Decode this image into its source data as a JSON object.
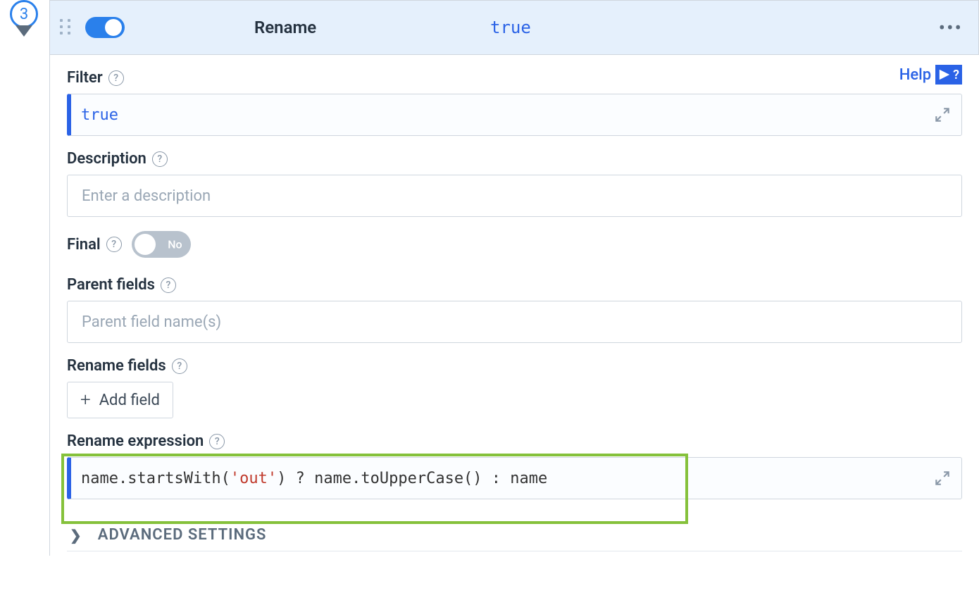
{
  "step": {
    "number": "3"
  },
  "header": {
    "title": "Rename",
    "value": "true"
  },
  "help": {
    "label": "Help"
  },
  "filter": {
    "label": "Filter",
    "value": "true"
  },
  "description": {
    "label": "Description",
    "placeholder": "Enter a description"
  },
  "final": {
    "label": "Final",
    "toggle_label": "No"
  },
  "parent": {
    "label": "Parent fields",
    "placeholder": "Parent field name(s)"
  },
  "rename_fields": {
    "label": "Rename fields",
    "add_label": "Add field"
  },
  "expr": {
    "label": "Rename expression",
    "value_pre": "name.startsWith(",
    "value_str": "'out'",
    "value_post": ") ? name.toUpperCase() : name"
  },
  "advanced": {
    "label": "ADVANCED SETTINGS"
  }
}
